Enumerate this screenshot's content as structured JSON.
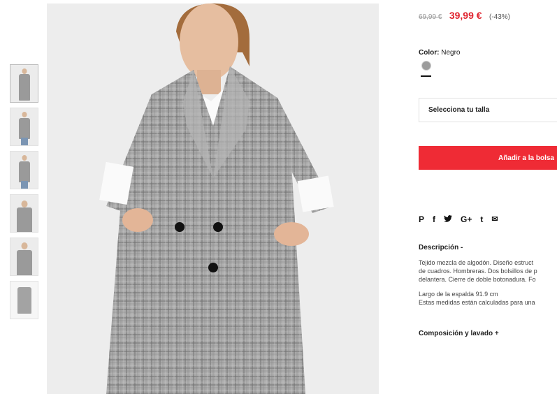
{
  "product": {
    "old_price": "69,99 €",
    "new_price": "39,99 €",
    "discount": "(-43%)"
  },
  "color": {
    "label": "Color:",
    "value": "Negro",
    "swatch_color": "#9c9c9c"
  },
  "size": {
    "placeholder": "Selecciona tu talla"
  },
  "cart": {
    "add_label": "Añadir a la bolsa",
    "button_color": "#ef2b35"
  },
  "share": {
    "icons": [
      {
        "name": "pinterest-icon",
        "glyph": "P"
      },
      {
        "name": "facebook-icon",
        "glyph": "f"
      },
      {
        "name": "twitter-icon",
        "glyph": "🐦"
      },
      {
        "name": "google-plus-icon",
        "glyph": "G+"
      },
      {
        "name": "tumblr-icon",
        "glyph": "t"
      },
      {
        "name": "email-icon",
        "glyph": "✉"
      }
    ]
  },
  "description": {
    "title": "Descripción -",
    "lines": [
      "Tejido mezcla de algodón. Diseño estruct",
      "de cuadros. Hombreras. Dos bolsillos de p",
      "delantera. Cierre de doble botonadura. Fo"
    ],
    "measure_lines": [
      "Largo de la espalda 91.9 cm",
      "Estas medidas están calculadas para una"
    ]
  },
  "composition": {
    "title": "Composición y lavado +"
  },
  "thumbnails": [
    {
      "name": "thumbnail-1"
    },
    {
      "name": "thumbnail-2"
    },
    {
      "name": "thumbnail-3"
    },
    {
      "name": "thumbnail-4"
    },
    {
      "name": "thumbnail-5"
    },
    {
      "name": "thumbnail-6"
    }
  ]
}
